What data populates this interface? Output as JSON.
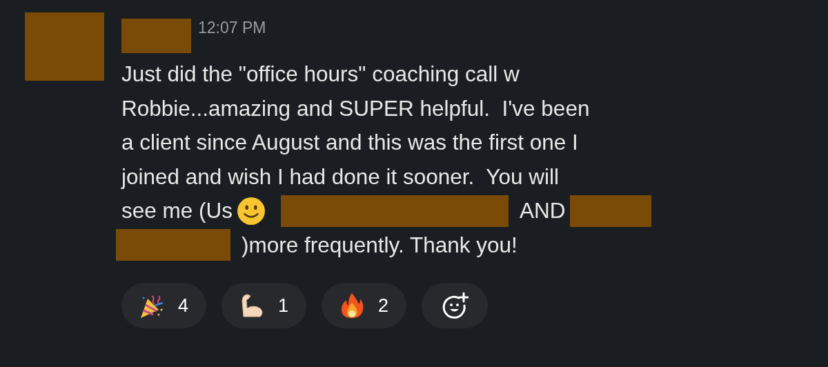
{
  "message": {
    "time": "12:07 PM",
    "author_redacted": true,
    "lines": [
      [
        {
          "kind": "text",
          "text": "Just did the \"office hours\" coaching call w"
        }
      ],
      [
        {
          "kind": "text",
          "text": "Robbie...amazing and SUPER helpful.  I've been"
        }
      ],
      [
        {
          "kind": "text",
          "text": "a client since August and this was the first one I"
        }
      ],
      [
        {
          "kind": "text",
          "text": "joined and wish I had done it sooner.  You will"
        }
      ],
      [
        {
          "kind": "text",
          "text": "see me (Us"
        },
        {
          "kind": "emoji"
        },
        {
          "kind": "redacted"
        },
        {
          "kind": "text",
          "text": "AND"
        },
        {
          "kind": "redacted"
        }
      ],
      [
        {
          "kind": "redacted"
        },
        {
          "kind": "text",
          "text": ")more frequently. Thank you!"
        }
      ]
    ]
  },
  "reactions": [
    {
      "kind": "party",
      "count": "4"
    },
    {
      "kind": "muscle",
      "count": "1"
    },
    {
      "kind": "fire",
      "count": "2"
    },
    {
      "kind": "add"
    }
  ]
}
